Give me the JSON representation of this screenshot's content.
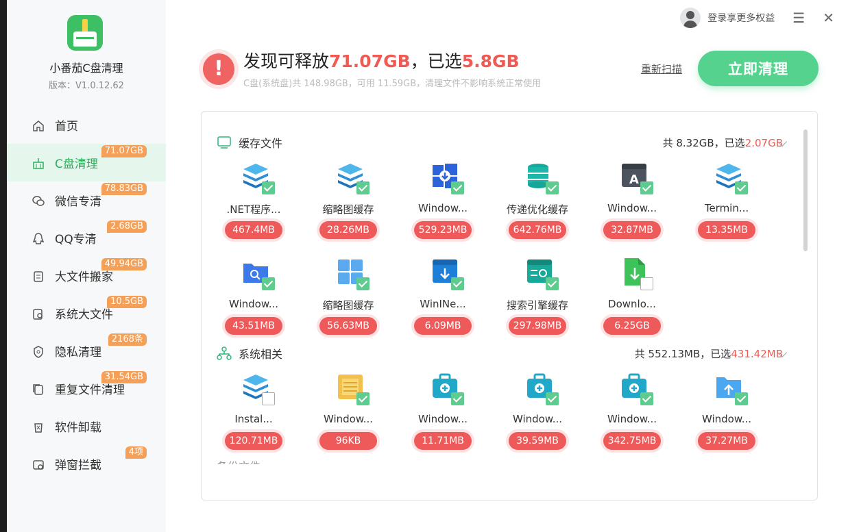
{
  "app": {
    "name": "小番茄C盘清理",
    "version": "版本：V1.0.12.62"
  },
  "sidebar": {
    "items": [
      {
        "label": "首页",
        "badge": ""
      },
      {
        "label": "C盘清理",
        "badge": "71.07GB"
      },
      {
        "label": "微信专清",
        "badge": "78.83GB"
      },
      {
        "label": "QQ专清",
        "badge": "2.68GB"
      },
      {
        "label": "大文件搬家",
        "badge": "49.94GB"
      },
      {
        "label": "系统大文件",
        "badge": "10.5GB"
      },
      {
        "label": "隐私清理",
        "badge": "2168条"
      },
      {
        "label": "重复文件清理",
        "badge": "31.54GB"
      },
      {
        "label": "软件卸载",
        "badge": ""
      },
      {
        "label": "弹窗拦截",
        "badge": "4项"
      }
    ]
  },
  "topbar": {
    "login_text": "登录享更多权益",
    "menu_icon": "☰",
    "close_icon": "✕"
  },
  "header": {
    "prefix": "发现可释放",
    "releasable": "71.07GB",
    "middle": "，已选",
    "selected": "5.8GB",
    "subtitle": "C盘(系统盘)共 148.98GB，可用 11.59GB，清理文件不影响系统正常使用",
    "rescan_label": "重新扫描",
    "clean_label": "立即清理"
  },
  "sections": [
    {
      "title": "缓存文件",
      "summary_prefix": "共 8.32GB，已选",
      "summary_selected": "2.07GB",
      "items": [
        {
          "name": ".NET程序...",
          "size": "467.4MB",
          "checked": true,
          "icon": "stack-icon"
        },
        {
          "name": "缩略图缓存",
          "size": "28.26MB",
          "checked": true,
          "icon": "stack-icon"
        },
        {
          "name": "Window...",
          "size": "529.23MB",
          "checked": true,
          "icon": "windows-update-icon"
        },
        {
          "name": "传递优化缓存",
          "size": "642.76MB",
          "checked": true,
          "icon": "database-icon"
        },
        {
          "name": "Window...",
          "size": "32.87MB",
          "checked": true,
          "icon": "font-window-icon"
        },
        {
          "name": "Termin...",
          "size": "13.35MB",
          "checked": true,
          "icon": "stack-icon"
        },
        {
          "name": "Window...",
          "size": "43.51MB",
          "checked": true,
          "icon": "folder-search-icon"
        },
        {
          "name": "缩略图缓存",
          "size": "56.63MB",
          "checked": true,
          "icon": "grid-icon"
        },
        {
          "name": "WinINe...",
          "size": "6.09MB",
          "checked": true,
          "icon": "download-window-icon"
        },
        {
          "name": "搜索引擎缓存",
          "size": "297.98MB",
          "checked": true,
          "icon": "search-window-icon"
        },
        {
          "name": "Downlo...",
          "size": "6.25GB",
          "checked": false,
          "icon": "download-file-icon"
        }
      ]
    },
    {
      "title": "系统相关",
      "summary_prefix": "共 552.13MB，已选",
      "summary_selected": "431.42MB",
      "items": [
        {
          "name": "Instal...",
          "size": "120.71MB",
          "checked": false,
          "icon": "stack-icon"
        },
        {
          "name": "Window...",
          "size": "96KB",
          "checked": true,
          "icon": "log-file-icon"
        },
        {
          "name": "Window...",
          "size": "11.71MB",
          "checked": true,
          "icon": "toolbox-icon"
        },
        {
          "name": "Window...",
          "size": "39.59MB",
          "checked": true,
          "icon": "toolbox-icon"
        },
        {
          "name": "Window...",
          "size": "342.75MB",
          "checked": true,
          "icon": "toolbox-icon"
        },
        {
          "name": "Window...",
          "size": "37.27MB",
          "checked": true,
          "icon": "upload-folder-icon"
        }
      ]
    }
  ],
  "partial_section_title": "备份文件"
}
